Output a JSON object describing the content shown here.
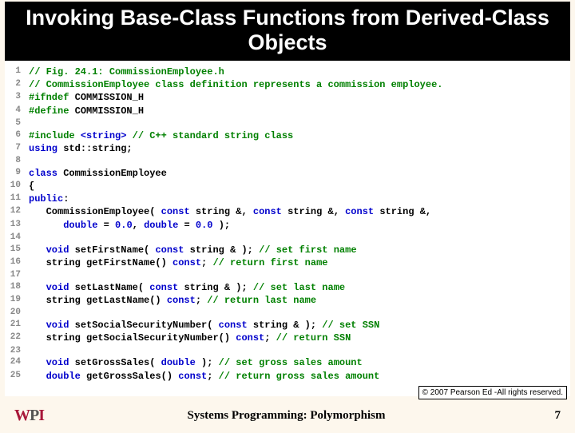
{
  "title": "Invoking Base-Class Functions from Derived-Class Objects",
  "copyright": "© 2007 Pearson Ed -All rights reserved.",
  "footer": {
    "logo_w": "W",
    "logo_p": "P",
    "logo_i": "I",
    "caption": "Systems Programming:  Polymorphism",
    "page": "7"
  },
  "code": [
    {
      "n": "1",
      "segs": [
        {
          "t": "// Fig. 24.1: CommissionEmployee.h",
          "c": "cm"
        }
      ]
    },
    {
      "n": "2",
      "segs": [
        {
          "t": "// CommissionEmployee class definition represents a commission employee.",
          "c": "cm"
        }
      ]
    },
    {
      "n": "3",
      "segs": [
        {
          "t": "#ifndef",
          "c": "pp"
        },
        {
          "t": " COMMISSION_H",
          "c": ""
        }
      ]
    },
    {
      "n": "4",
      "segs": [
        {
          "t": "#define",
          "c": "pp"
        },
        {
          "t": " COMMISSION_H",
          "c": ""
        }
      ]
    },
    {
      "n": "5",
      "segs": [
        {
          "t": "",
          "c": ""
        }
      ]
    },
    {
      "n": "6",
      "segs": [
        {
          "t": "#include ",
          "c": "pp"
        },
        {
          "t": "<string>",
          "c": "kw"
        },
        {
          "t": " // C++ standard string class",
          "c": "cm"
        }
      ]
    },
    {
      "n": "7",
      "segs": [
        {
          "t": "using",
          "c": "kw"
        },
        {
          "t": " std::string;",
          "c": ""
        }
      ]
    },
    {
      "n": "8",
      "segs": [
        {
          "t": "",
          "c": ""
        }
      ]
    },
    {
      "n": "9",
      "segs": [
        {
          "t": "class",
          "c": "kw"
        },
        {
          "t": " CommissionEmployee",
          "c": ""
        }
      ]
    },
    {
      "n": "10",
      "segs": [
        {
          "t": "{",
          "c": ""
        }
      ]
    },
    {
      "n": "11",
      "segs": [
        {
          "t": "public",
          "c": "kw"
        },
        {
          "t": ":",
          "c": ""
        }
      ]
    },
    {
      "n": "12",
      "segs": [
        {
          "t": "   CommissionEmployee( ",
          "c": ""
        },
        {
          "t": "const",
          "c": "kw"
        },
        {
          "t": " string &, ",
          "c": ""
        },
        {
          "t": "const",
          "c": "kw"
        },
        {
          "t": " string &, ",
          "c": ""
        },
        {
          "t": "const",
          "c": "kw"
        },
        {
          "t": " string &,",
          "c": ""
        }
      ]
    },
    {
      "n": "13",
      "segs": [
        {
          "t": "      ",
          "c": ""
        },
        {
          "t": "double",
          "c": "kw"
        },
        {
          "t": " = ",
          "c": ""
        },
        {
          "t": "0.0",
          "c": "kw"
        },
        {
          "t": ", ",
          "c": ""
        },
        {
          "t": "double",
          "c": "kw"
        },
        {
          "t": " = ",
          "c": ""
        },
        {
          "t": "0.0",
          "c": "kw"
        },
        {
          "t": " );",
          "c": ""
        }
      ]
    },
    {
      "n": "14",
      "segs": [
        {
          "t": "",
          "c": ""
        }
      ]
    },
    {
      "n": "15",
      "segs": [
        {
          "t": "   ",
          "c": ""
        },
        {
          "t": "void",
          "c": "kw"
        },
        {
          "t": " setFirstName( ",
          "c": ""
        },
        {
          "t": "const",
          "c": "kw"
        },
        {
          "t": " string & ); ",
          "c": ""
        },
        {
          "t": "// set first name",
          "c": "cm"
        }
      ]
    },
    {
      "n": "16",
      "segs": [
        {
          "t": "   string getFirstName() ",
          "c": ""
        },
        {
          "t": "const",
          "c": "kw"
        },
        {
          "t": "; ",
          "c": ""
        },
        {
          "t": "// return first name",
          "c": "cm"
        }
      ]
    },
    {
      "n": "17",
      "segs": [
        {
          "t": "",
          "c": ""
        }
      ]
    },
    {
      "n": "18",
      "segs": [
        {
          "t": "   ",
          "c": ""
        },
        {
          "t": "void",
          "c": "kw"
        },
        {
          "t": " setLastName( ",
          "c": ""
        },
        {
          "t": "const",
          "c": "kw"
        },
        {
          "t": " string & ); ",
          "c": ""
        },
        {
          "t": "// set last name",
          "c": "cm"
        }
      ]
    },
    {
      "n": "19",
      "segs": [
        {
          "t": "   string getLastName() ",
          "c": ""
        },
        {
          "t": "const",
          "c": "kw"
        },
        {
          "t": "; ",
          "c": ""
        },
        {
          "t": "// return last name",
          "c": "cm"
        }
      ]
    },
    {
      "n": "20",
      "segs": [
        {
          "t": "",
          "c": ""
        }
      ]
    },
    {
      "n": "21",
      "segs": [
        {
          "t": "   ",
          "c": ""
        },
        {
          "t": "void",
          "c": "kw"
        },
        {
          "t": " setSocialSecurityNumber( ",
          "c": ""
        },
        {
          "t": "const",
          "c": "kw"
        },
        {
          "t": " string & ); ",
          "c": ""
        },
        {
          "t": "// set SSN",
          "c": "cm"
        }
      ]
    },
    {
      "n": "22",
      "segs": [
        {
          "t": "   string getSocialSecurityNumber() ",
          "c": ""
        },
        {
          "t": "const",
          "c": "kw"
        },
        {
          "t": "; ",
          "c": ""
        },
        {
          "t": "// return SSN",
          "c": "cm"
        }
      ]
    },
    {
      "n": "23",
      "segs": [
        {
          "t": "",
          "c": ""
        }
      ]
    },
    {
      "n": "24",
      "segs": [
        {
          "t": "   ",
          "c": ""
        },
        {
          "t": "void",
          "c": "kw"
        },
        {
          "t": " setGrossSales( ",
          "c": ""
        },
        {
          "t": "double",
          "c": "kw"
        },
        {
          "t": " ); ",
          "c": ""
        },
        {
          "t": "// set gross sales amount",
          "c": "cm"
        }
      ]
    },
    {
      "n": "25",
      "segs": [
        {
          "t": "   ",
          "c": ""
        },
        {
          "t": "double",
          "c": "kw"
        },
        {
          "t": " getGrossSales() ",
          "c": ""
        },
        {
          "t": "const",
          "c": "kw"
        },
        {
          "t": "; ",
          "c": ""
        },
        {
          "t": "// return gross sales amount",
          "c": "cm"
        }
      ]
    }
  ]
}
